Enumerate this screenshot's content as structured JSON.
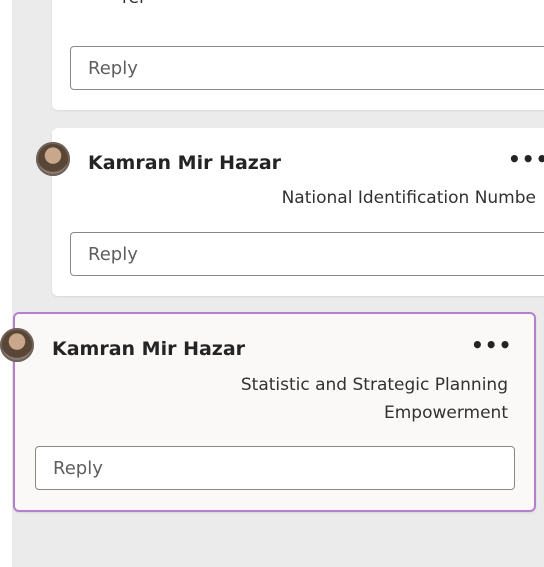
{
  "comments": [
    {
      "author": "",
      "text_partial": "rer",
      "reply_placeholder": "Reply"
    },
    {
      "author": "Kamran Mir Hazar",
      "text_line1": "National Identification Numbe",
      "more_label": "•••",
      "reply_placeholder": "Reply"
    },
    {
      "author": "Kamran Mir Hazar",
      "text_line1": "Statistic and Strategic Planning",
      "text_line2": "Empowerment",
      "more_label": "•••",
      "reply_placeholder": "Reply",
      "active": true
    }
  ],
  "colors": {
    "pane_background": "#ebebeb",
    "card_background": "#ffffff",
    "active_border": "#b57fcc"
  }
}
